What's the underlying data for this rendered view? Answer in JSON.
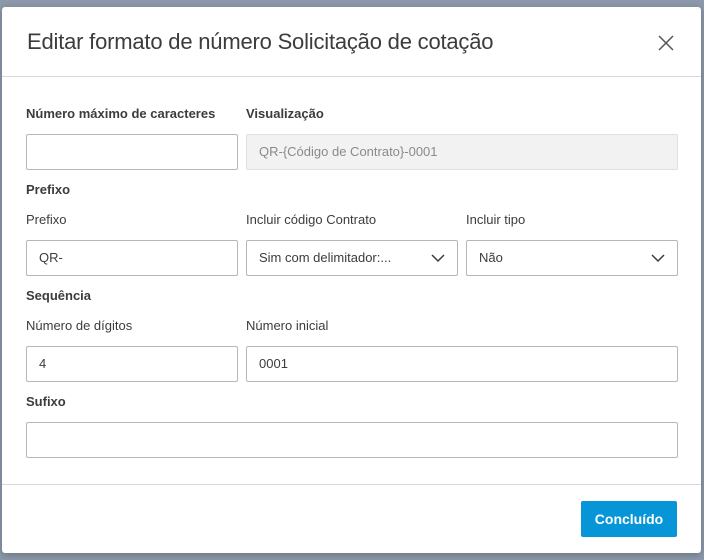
{
  "dialog": {
    "title": "Editar formato de número Solicitação de cotação",
    "done_label": "Concluído"
  },
  "fields": {
    "max_chars": {
      "label": "Número máximo de caracteres",
      "value": ""
    },
    "preview": {
      "label": "Visualização",
      "value": "QR-{Código de Contrato}-0001"
    },
    "prefix_section": "Prefixo",
    "prefix": {
      "label": "Prefixo",
      "value": "QR-"
    },
    "include_contract_code": {
      "label": "Incluir código Contrato",
      "value": "Sim com delimitador:..."
    },
    "include_type": {
      "label": "Incluir tipo",
      "value": "Não"
    },
    "sequence_section": "Sequência",
    "digits": {
      "label": "Número de dígitos",
      "value": "4"
    },
    "start_number": {
      "label": "Número inicial",
      "value": "0001"
    },
    "suffix": {
      "label": "Sufixo",
      "value": ""
    }
  },
  "colors": {
    "accent": "#0696d7",
    "backdrop": "#8c99aa"
  }
}
